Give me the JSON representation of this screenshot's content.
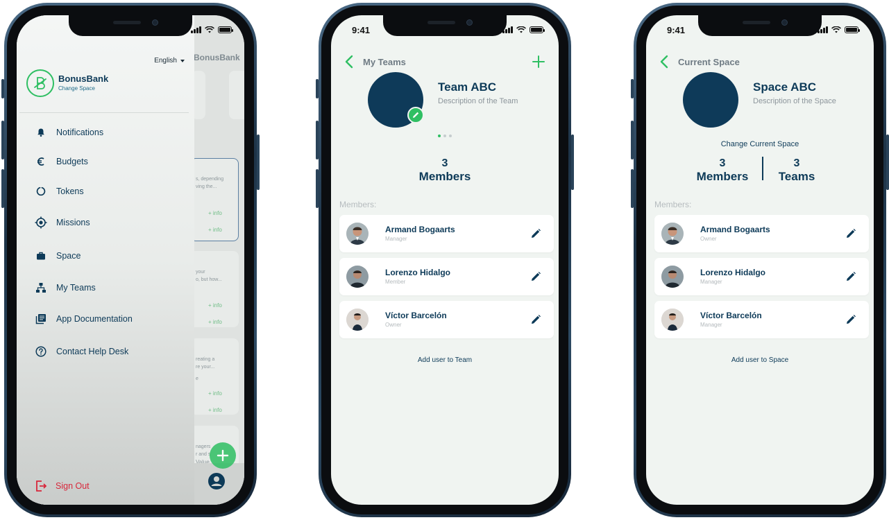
{
  "colors": {
    "brand_navy": "#0d3a58",
    "accent_green": "#2fbf63",
    "danger_red": "#d8263a",
    "screen_bg": "#f0f4f1"
  },
  "phone1": {
    "status": {
      "signal": "cellular-signal-icon",
      "wifi": "wifi-icon",
      "battery": "battery-icon"
    },
    "background_app": {
      "title": "BonusBank",
      "snippets": [
        "s, depending",
        "ving the...",
        "your",
        "o, but how...",
        "e",
        "reating a",
        "re your...",
        "nagers",
        "r and s",
        "Value"
      ],
      "info_links": [
        "+ info",
        "+ info",
        "+ info",
        "+ info",
        "+ info",
        "+ info"
      ]
    },
    "drawer": {
      "language": "English",
      "brand_name": "BonusBank",
      "brand_sub": "Change Space",
      "menu": [
        {
          "label": "Notifications",
          "icon": "bell-icon"
        },
        {
          "label": "Budgets",
          "icon": "euro-icon"
        },
        {
          "label": "Tokens",
          "icon": "circle-notch-icon"
        },
        {
          "label": "Missions",
          "icon": "target-icon"
        },
        {
          "label": "Space",
          "icon": "briefcase-icon"
        },
        {
          "label": "My Teams",
          "icon": "org-chart-icon"
        },
        {
          "label": "App Documentation",
          "icon": "document-stack-icon"
        },
        {
          "label": "Contact Help Desk",
          "icon": "help-circle-icon"
        }
      ],
      "sign_out": "Sign Out"
    }
  },
  "phone2": {
    "time": "9:41",
    "header_title": "My Teams",
    "entity_name": "Team ABC",
    "entity_desc": "Description of the Team",
    "stats": [
      {
        "number": "3",
        "label": "Members"
      }
    ],
    "members_label": "Members:",
    "members": [
      {
        "name": "Armand Bogaarts",
        "role": "Manager"
      },
      {
        "name": "Lorenzo Hidalgo",
        "role": "Member"
      },
      {
        "name": "Víctor Barcelón",
        "role": "Owner"
      }
    ],
    "add_link": "Add user to Team"
  },
  "phone3": {
    "time": "9:41",
    "header_title": "Current Space",
    "entity_name": "Space ABC",
    "entity_desc": "Description of the Space",
    "change_label": "Change Current Space",
    "stats": [
      {
        "number": "3",
        "label": "Members"
      },
      {
        "number": "3",
        "label": "Teams"
      }
    ],
    "members_label": "Members:",
    "members": [
      {
        "name": "Armand Bogaarts",
        "role": "Owner"
      },
      {
        "name": "Lorenzo Hidalgo",
        "role": "Manager"
      },
      {
        "name": "Víctor Barcelón",
        "role": "Manager"
      }
    ],
    "add_link": "Add user to Space"
  }
}
